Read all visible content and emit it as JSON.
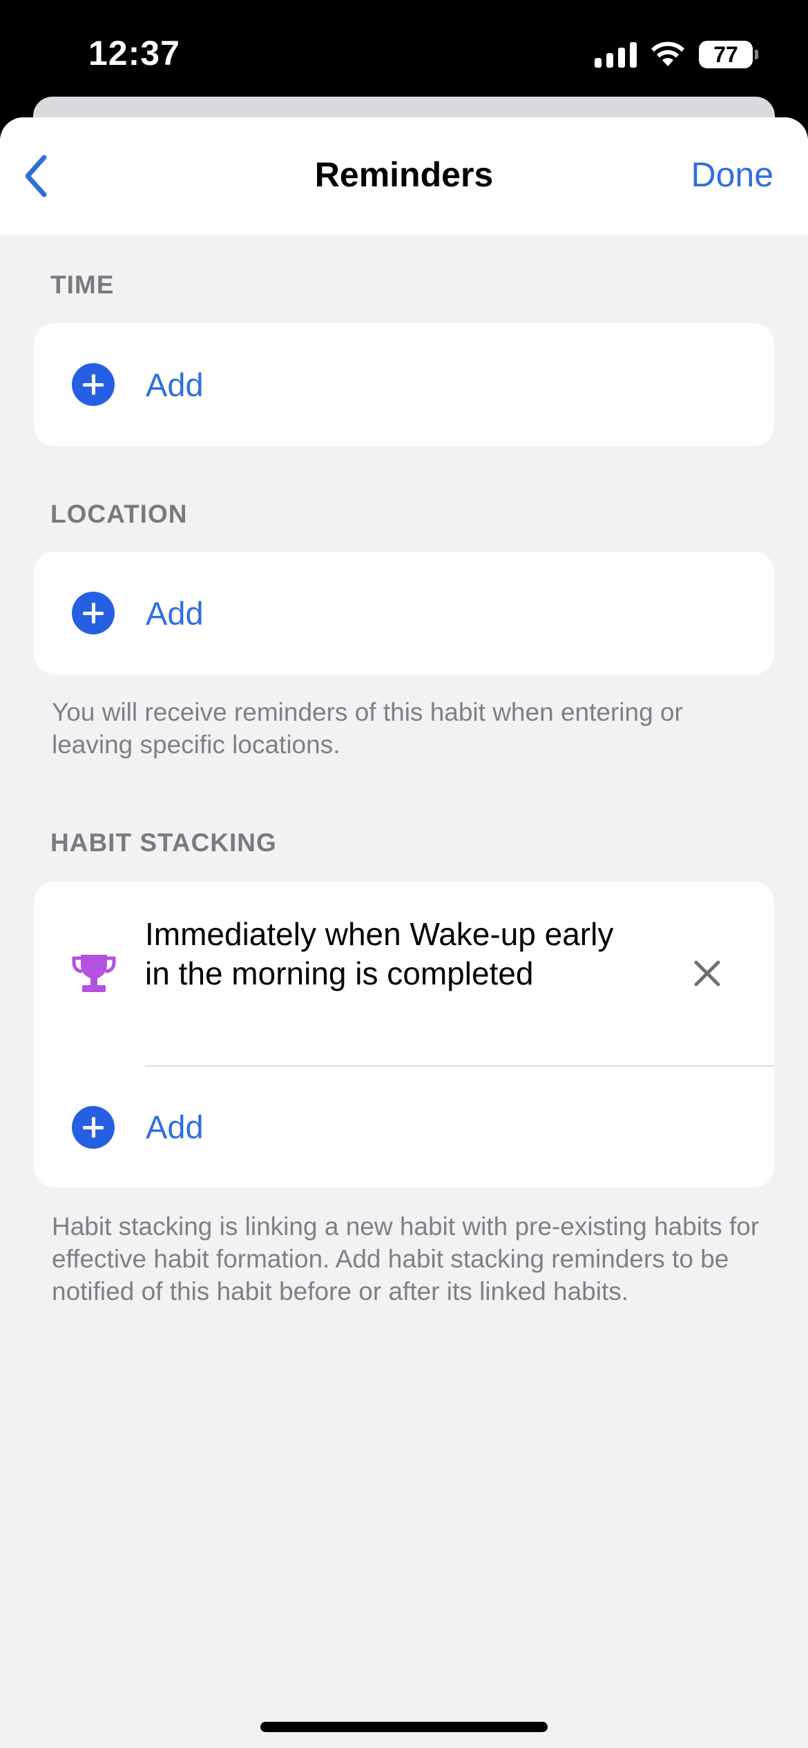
{
  "status_bar": {
    "time": "12:37",
    "battery": "77",
    "icons": [
      "cellular-signal-icon",
      "wifi-icon",
      "battery-icon"
    ]
  },
  "nav": {
    "title": "Reminders",
    "done_label": "Done",
    "back_icon": "chevron-left-icon"
  },
  "sections": {
    "time": {
      "label": "TIME",
      "add_label": "Add"
    },
    "location": {
      "label": "LOCATION",
      "add_label": "Add",
      "footnote": "You will receive reminders of this habit when entering or leaving specific locations."
    },
    "habit_stacking": {
      "label": "HABIT STACKING",
      "items": [
        {
          "icon": "trophy-icon",
          "text": "Immediately when Wake-up early in the morning  is completed"
        }
      ],
      "add_label": "Add",
      "footnote": "Habit stacking is linking a new habit with pre-existing habits for effective habit formation. Add habit stacking reminders to be notified of this habit before or after its linked habits."
    }
  },
  "colors": {
    "accent": "#2F6FDC",
    "plus_circle": "#2660E2",
    "trophy": "#B452E0",
    "background": "#F2F2F4"
  }
}
